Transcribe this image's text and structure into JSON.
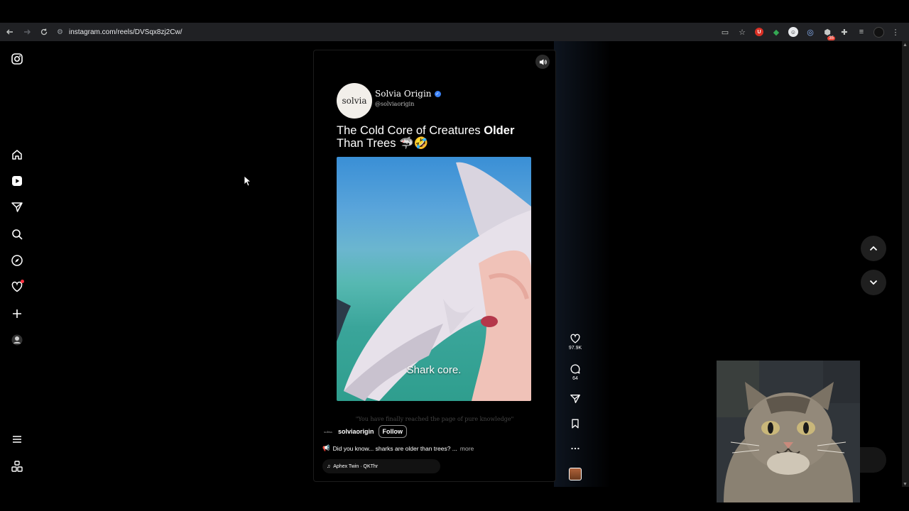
{
  "browser": {
    "url": "instagram.com/reels/DVSqx8zj2Cw/",
    "extension_badge": "35"
  },
  "reel": {
    "account_name": "Solvia Origin",
    "account_handle": "@solviaorigin",
    "avatar_text": "solvia",
    "headline_part1": "The Cold Core of Creatures ",
    "headline_bold": "Older",
    "headline_part2": " Than Trees 🦈🤣",
    "video_caption": "Shark core.",
    "quote": "\"You have finally reached the page of pure knowledge\"",
    "mini_logo_text": "solvia",
    "byline_user": "solviaorigin",
    "follow_label": "Follow",
    "description_emoji": "📢",
    "description": "Did you know... sharks are older than trees? ...",
    "more_label": "more",
    "audio_track": "Aphex Twin · QKThr"
  },
  "actions": {
    "likes": "97.9K",
    "comments": "64"
  }
}
